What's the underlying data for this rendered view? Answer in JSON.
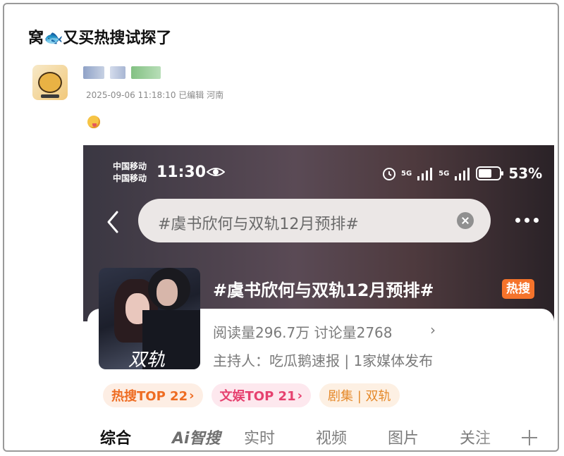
{
  "post": {
    "title": "窝🐟又买热搜试探了",
    "meta": "2025-09-06 11:18:10 已编辑 河南"
  },
  "screenshot": {
    "status": {
      "carrier_1": "中国移动",
      "carrier_2": "中国移动",
      "time": "11:30",
      "network_1": "5G",
      "network_2": "5G",
      "battery": "53%"
    },
    "search": {
      "query": "#虞书欣何与双轨12月预排#"
    },
    "topic": {
      "poster_title": "双轨",
      "title": "#虞书欣何与双轨12月预排#",
      "badge": "热搜",
      "stats": "阅读量296.7万 讨论量2768",
      "host": "主持人：吃瓜鹅速报 | 1家媒体发布"
    },
    "tags": [
      {
        "label": "热搜TOP 22",
        "arrow": "›"
      },
      {
        "label": "文娱TOP 21",
        "arrow": "›"
      },
      {
        "label": "剧集 | 双轨"
      }
    ],
    "tabs": [
      "综合",
      "Ai智搜",
      "实时",
      "视频",
      "图片",
      "关注"
    ],
    "colors": {
      "hot_orange": "#f5732b",
      "ent_pink": "#e6416f"
    }
  }
}
